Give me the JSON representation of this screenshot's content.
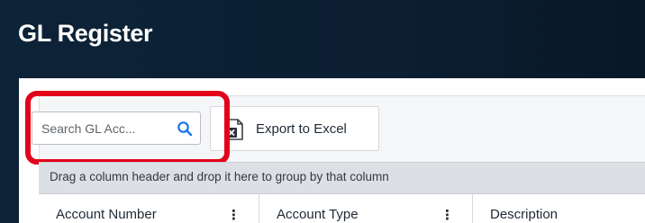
{
  "page": {
    "title": "GL Register"
  },
  "toolbar": {
    "search_placeholder": "Search GL Acc...",
    "search_icon": "search-icon",
    "export_label": "Export to Excel",
    "export_icon": "excel-icon"
  },
  "grid": {
    "group_panel_text": "Drag a column header and drop it here to group by that column",
    "columns": [
      {
        "label": "Account Number",
        "menu": "⋮"
      },
      {
        "label": "Account Type",
        "menu": "⋮"
      },
      {
        "label": "Description",
        "menu": ""
      }
    ]
  },
  "colors": {
    "header_background": "#0c1f33",
    "highlight": "#e3001b",
    "search_icon": "#1a73e8",
    "group_panel": "#dcdfe3"
  }
}
